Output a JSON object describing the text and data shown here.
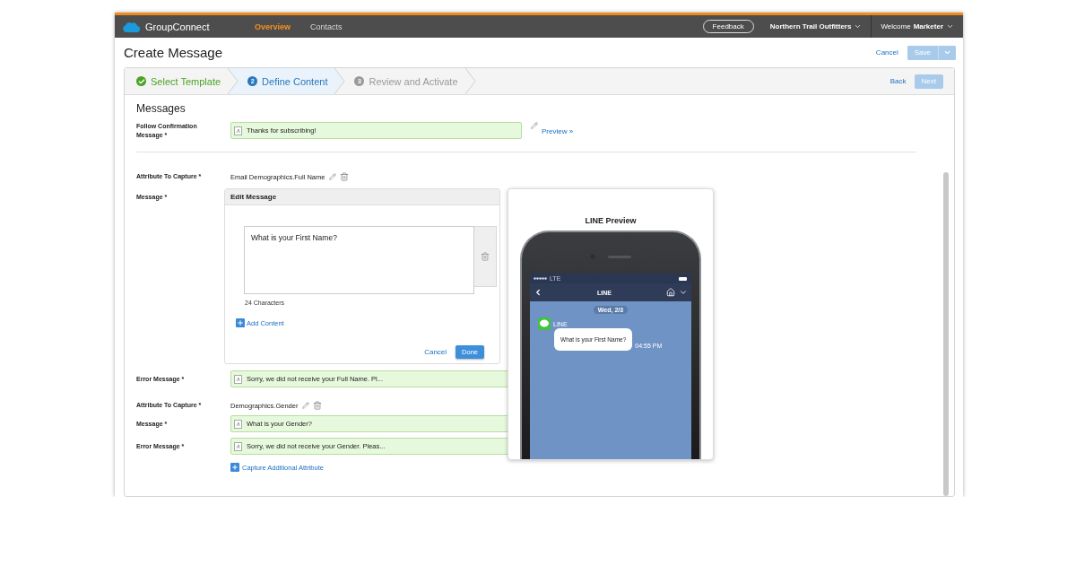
{
  "app": {
    "name": "GroupConnect"
  },
  "nav": [
    {
      "label": "Overview",
      "selected": true
    },
    {
      "label": "Contacts",
      "selected": false
    }
  ],
  "feedback": "Feedback",
  "org": "Northern Trail Outfitters",
  "welcome": "Welcome",
  "user": "Marketer",
  "page_title": "Create Message",
  "cancel": "Cancel",
  "save": {
    "label": "Save",
    "disabled": true
  },
  "steps": [
    {
      "label": "Select Template",
      "completed": true,
      "selected": false
    },
    {
      "number": "2",
      "label": "Define Content",
      "completed": false,
      "selected": true
    },
    {
      "number": "3",
      "label": "Review and Activate",
      "completed": false,
      "selected": false
    }
  ],
  "back": "Back",
  "next": {
    "label": "Next",
    "disabled": true
  },
  "section_title": "Messages",
  "follow": {
    "label": "Follow Confirmation Message *",
    "value": "Thanks for subscribing!",
    "link": "Preview »"
  },
  "rows": [
    {
      "kind": "attribute",
      "label": "Attribute To Capture *",
      "value": "Email Demographics.Full Name"
    },
    {
      "kind": "editor",
      "label": "Message *"
    },
    {
      "kind": "field",
      "label": "Error Message *",
      "value": "Sorry, we did not receive your Full Name. Pl..."
    },
    {
      "kind": "attribute",
      "label": "Attribute To Capture *",
      "value": "Demographics.Gender"
    },
    {
      "kind": "field",
      "label": "Message *",
      "value": "What is your Gender?"
    },
    {
      "kind": "field",
      "label": "Error Message *",
      "value": "Sorry, we did not receive your Gender. Pleas..."
    }
  ],
  "editor": {
    "title": "Edit Message",
    "text": "What is your First Name?",
    "count": "24 Characters",
    "add": "Add Content",
    "cancel": "Cancel",
    "done": "Done"
  },
  "capture_link": "Capture Additional Attribute",
  "preview": {
    "title": "LINE Preview",
    "carrier": "LTE",
    "chat_title": "LINE",
    "date": "Wed, 2/3",
    "sender": "LINE",
    "bubble": "What is your First Name?",
    "time": "04:55 PM"
  }
}
